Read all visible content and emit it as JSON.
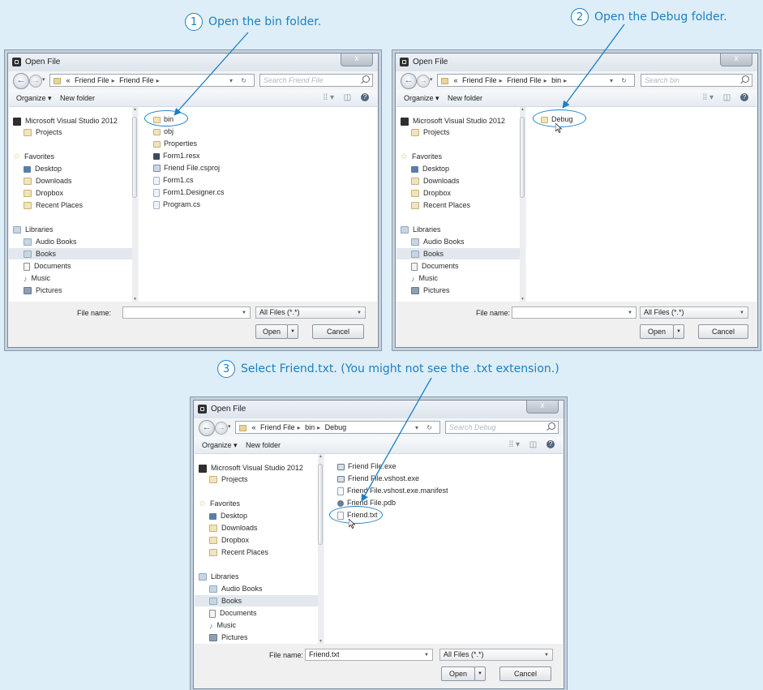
{
  "colors": {
    "background": "#ddeef8",
    "accent": "#1d7fc4"
  },
  "steps": [
    {
      "number": "1",
      "text": "Open the bin folder."
    },
    {
      "number": "2",
      "text": "Open the Debug folder."
    },
    {
      "number": "3",
      "text": "Select Friend.txt. (You might not see the .txt extension.)"
    }
  ],
  "dialogs": [
    {
      "title": "Open File",
      "close_label": "x",
      "breadcrumb": [
        "«",
        "Friend File",
        "Friend File"
      ],
      "search_placeholder": "Search Friend File",
      "toolbar": {
        "organize": "Organize ▾",
        "new_folder": "New folder",
        "view": "⁞⁞ ▾",
        "preview": "◫",
        "help": "?"
      },
      "nav": {
        "vs": "Microsoft Visual Studio 2012",
        "projects": "Projects",
        "favorites": "Favorites",
        "desktop": "Desktop",
        "downloads": "Downloads",
        "dropbox": "Dropbox",
        "recent": "Recent Places",
        "libraries": "Libraries",
        "audiobooks": "Audio Books",
        "books": "Books",
        "documents": "Documents",
        "music": "Music",
        "pictures": "Pictures"
      },
      "files": [
        "bin",
        "obj",
        "Properties",
        "Form1.resx",
        "Friend File.csproj",
        "Form1.cs",
        "Form1.Designer.cs",
        "Program.cs"
      ],
      "file_name_label": "File name:",
      "file_name_value": "",
      "filter": "All Files (*.*)",
      "open": "Open",
      "cancel": "Cancel"
    },
    {
      "title": "Open File",
      "close_label": "x",
      "breadcrumb": [
        "«",
        "Friend File",
        "Friend File",
        "bin"
      ],
      "search_placeholder": "Search bin",
      "toolbar": {
        "organize": "Organize ▾",
        "new_folder": "New folder",
        "view": "⁞⁞ ▾",
        "preview": "◫",
        "help": "?"
      },
      "nav": {
        "vs": "Microsoft Visual Studio 2012",
        "projects": "Projects",
        "favorites": "Favorites",
        "desktop": "Desktop",
        "downloads": "Downloads",
        "dropbox": "Dropbox",
        "recent": "Recent Places",
        "libraries": "Libraries",
        "audiobooks": "Audio Books",
        "books": "Books",
        "documents": "Documents",
        "music": "Music",
        "pictures": "Pictures"
      },
      "files": [
        "Debug"
      ],
      "file_name_label": "File name:",
      "file_name_value": "",
      "filter": "All Files (*.*)",
      "open": "Open",
      "cancel": "Cancel"
    },
    {
      "title": "Open File",
      "close_label": "x",
      "breadcrumb": [
        "«",
        "Friend File",
        "bin",
        "Debug"
      ],
      "search_placeholder": "Search Debug",
      "toolbar": {
        "organize": "Organize ▾",
        "new_folder": "New folder",
        "view": "⁞⁞ ▾",
        "preview": "◫",
        "help": "?"
      },
      "nav": {
        "vs": "Microsoft Visual Studio 2012",
        "projects": "Projects",
        "favorites": "Favorites",
        "desktop": "Desktop",
        "downloads": "Downloads",
        "dropbox": "Dropbox",
        "recent": "Recent Places",
        "libraries": "Libraries",
        "audiobooks": "Audio Books",
        "books": "Books",
        "documents": "Documents",
        "music": "Music",
        "pictures": "Pictures"
      },
      "files": [
        "Friend File.exe",
        "Friend File.vshost.exe",
        "Friend File.vshost.exe.manifest",
        "Friend File.pdb",
        "Friend.txt"
      ],
      "file_name_label": "File name:",
      "file_name_value": "Friend.txt",
      "filter": "All Files (*.*)",
      "open": "Open",
      "cancel": "Cancel"
    }
  ]
}
